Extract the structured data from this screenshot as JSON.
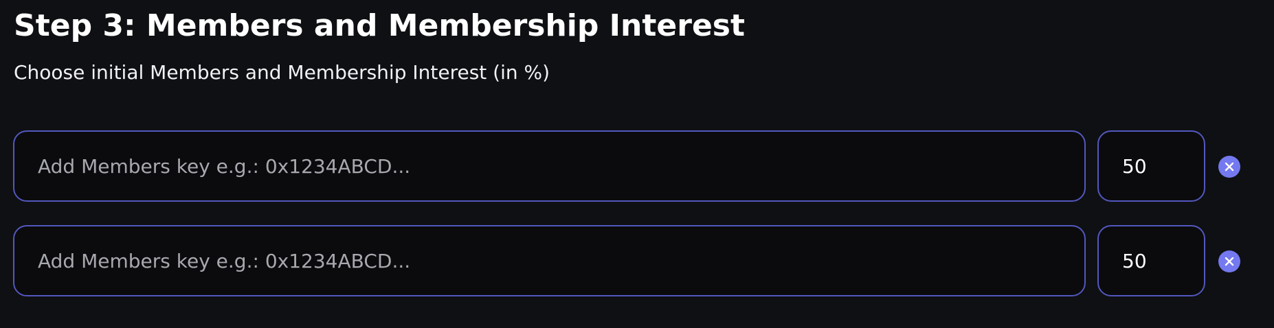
{
  "step": {
    "title": "Step 3: Members and Membership Interest",
    "subtitle": "Choose initial Members and Membership Interest (in %)"
  },
  "members": [
    {
      "key_value": "",
      "key_placeholder": "Add Members key e.g.: 0x1234ABCD...",
      "interest": "50",
      "remove_icon": "close-circle-icon"
    },
    {
      "key_value": "",
      "key_placeholder": "Add Members key e.g.: 0x1234ABCD...",
      "interest": "50",
      "remove_icon": "close-circle-icon"
    }
  ],
  "colors": {
    "background": "#0f1013",
    "input_background": "#0b0b0e",
    "input_border": "#5358bf",
    "accent": "#7479f0",
    "placeholder": "#a8a9ae",
    "text": "#ffffff"
  }
}
